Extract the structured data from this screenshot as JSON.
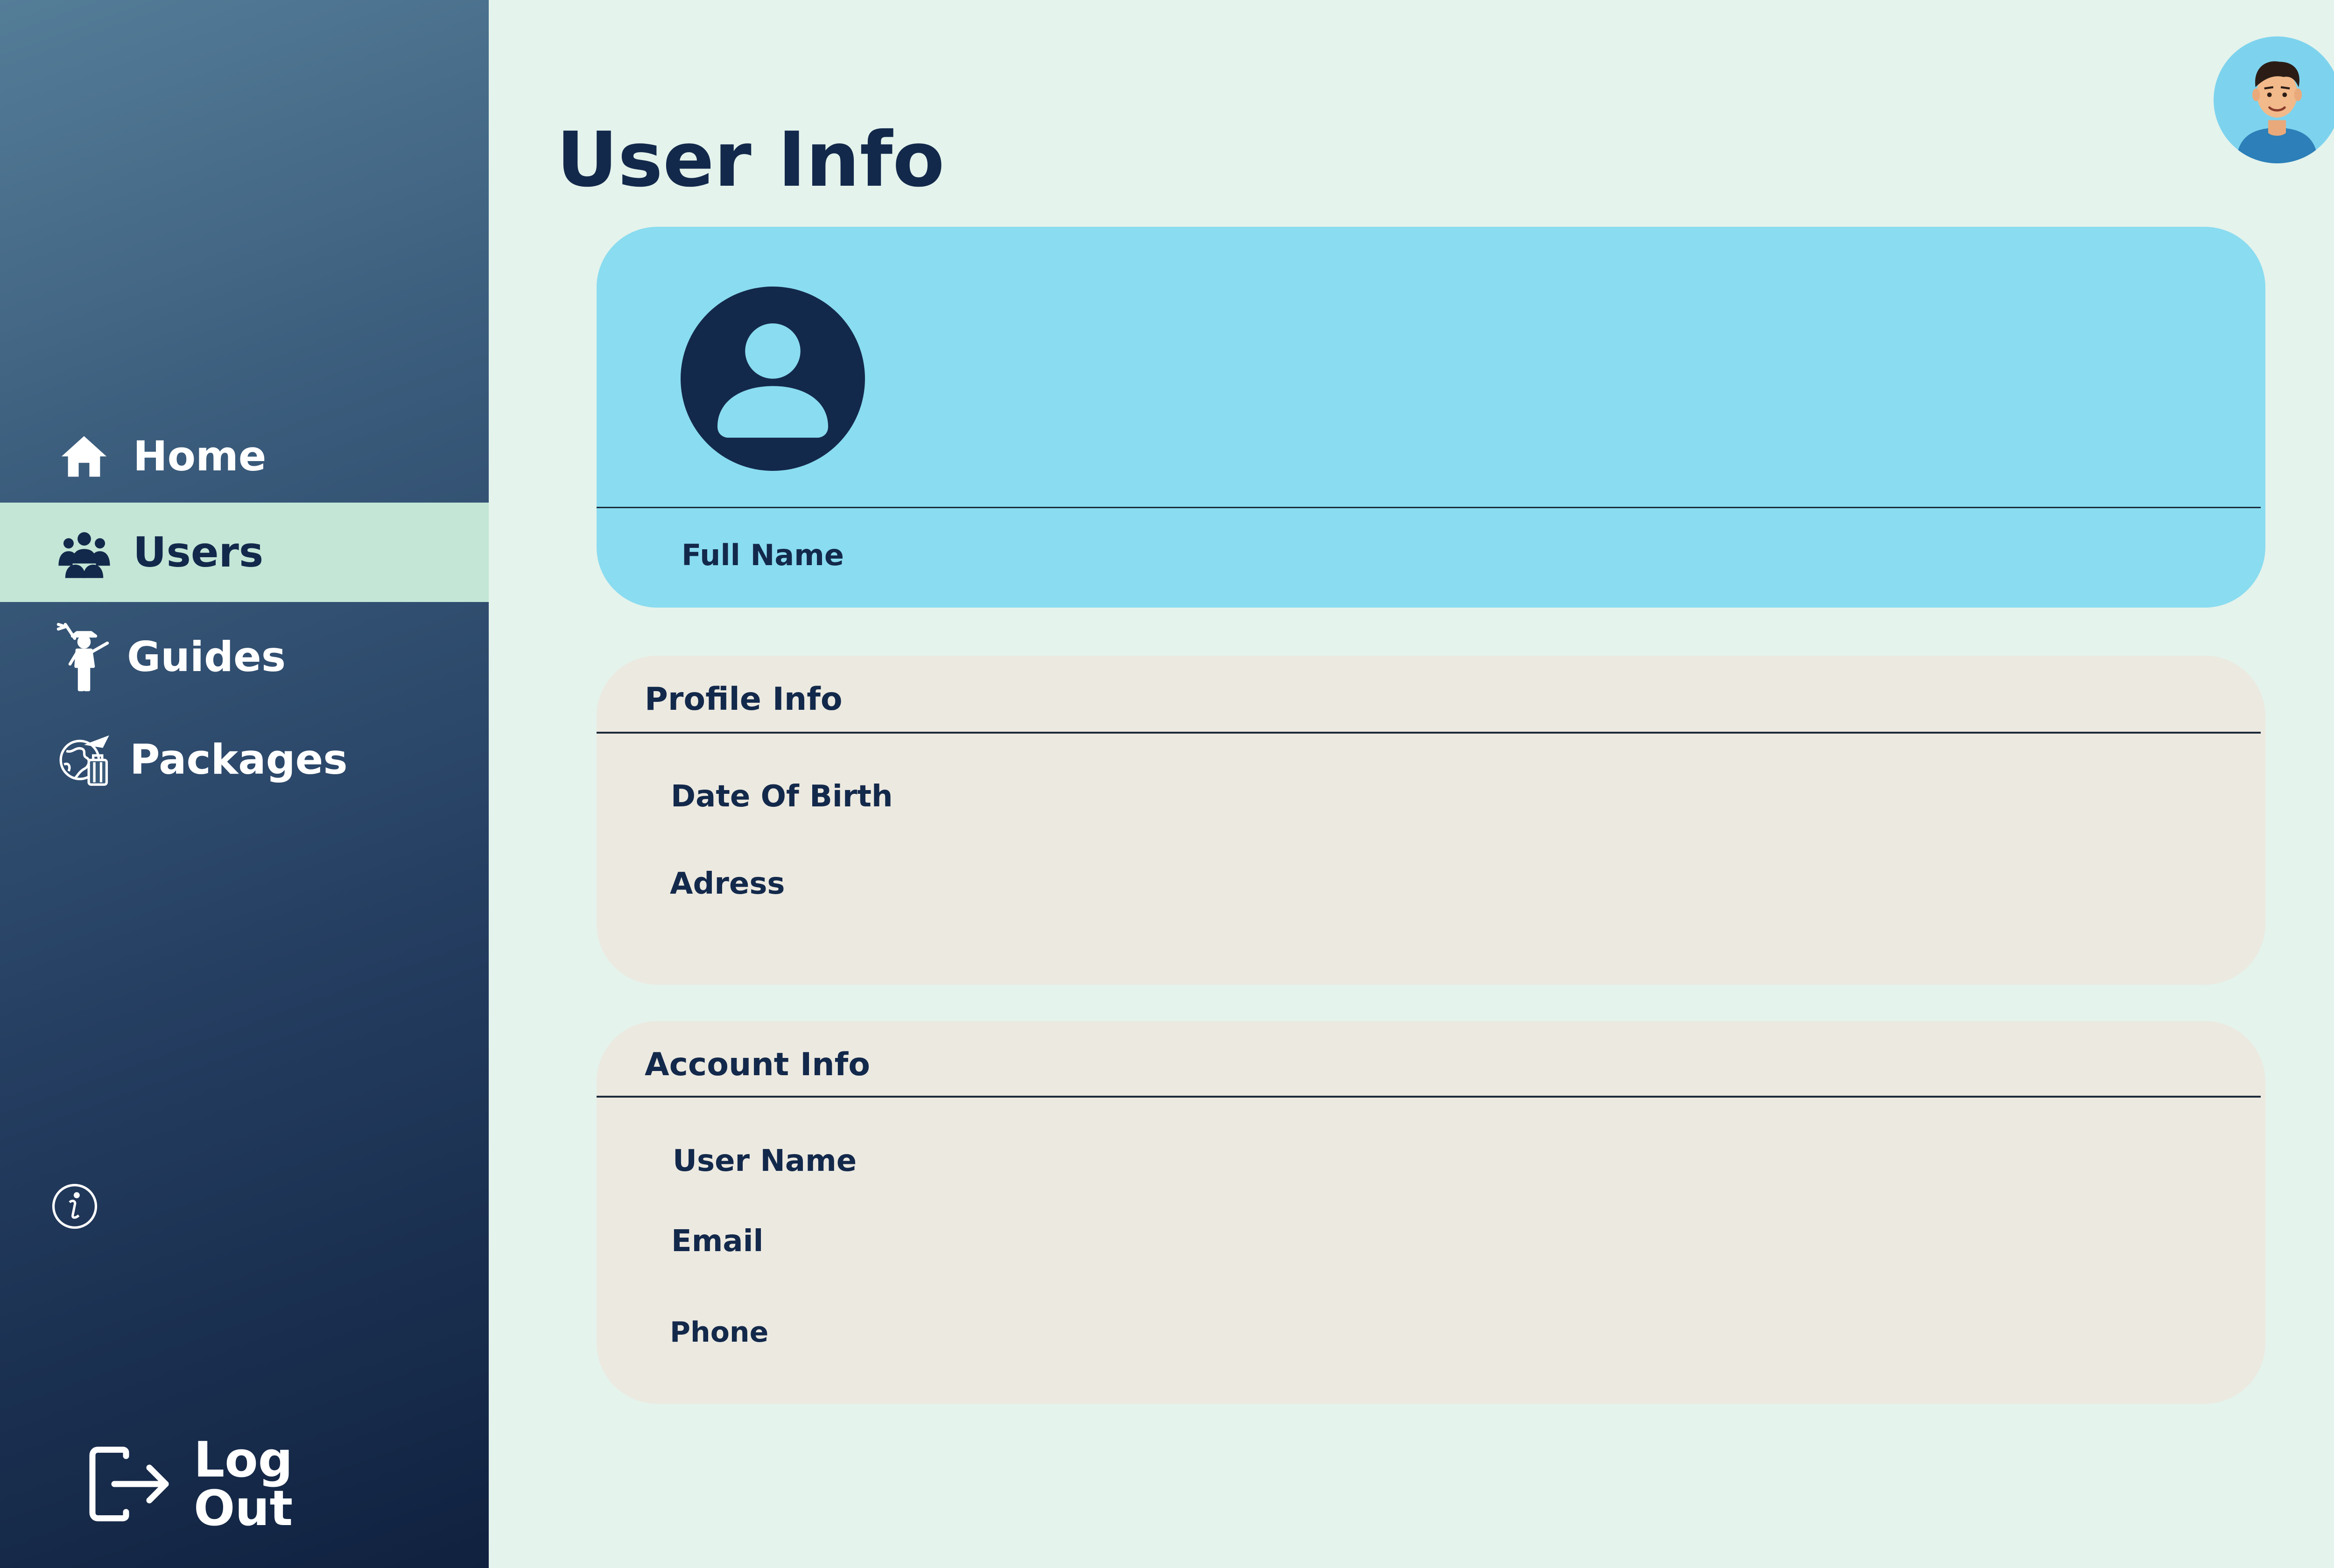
{
  "sidebar": {
    "items": [
      {
        "label": "Home",
        "icon": "home-icon",
        "active": false
      },
      {
        "label": "Users",
        "icon": "users-icon",
        "active": true
      },
      {
        "label": "Guides",
        "icon": "guide-icon",
        "active": false
      },
      {
        "label": "Packages",
        "icon": "travel-globe-icon",
        "active": false
      }
    ],
    "info_icon": "info-icon",
    "logout": {
      "label": "Log Out",
      "icon": "logout-icon"
    }
  },
  "header": {
    "title": "User Info",
    "avatar_icon": "user-avatar-icon"
  },
  "user_card": {
    "photo_icon": "user-placeholder-icon",
    "full_name_label": "Full  Name"
  },
  "profile_info": {
    "title": "Profile Info",
    "fields": [
      "Date Of Birth",
      "Adress"
    ]
  },
  "account_info": {
    "title": "Account Info",
    "fields": [
      "User Name",
      "Email",
      "Phone"
    ]
  },
  "colors": {
    "sidebar_top": "#547d98",
    "sidebar_bottom": "#10213f",
    "active_nav": "#c3e6d7",
    "page_background": "#e4f3ec",
    "user_card": "#8adcf0",
    "info_card": "#ece9e0",
    "text_dark": "#13294b"
  }
}
